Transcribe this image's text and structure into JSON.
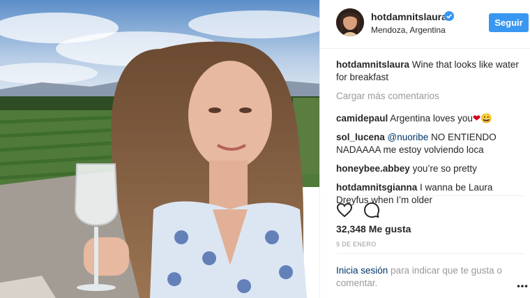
{
  "post": {
    "username": "hotdamnitslaura",
    "location": "Mendoza, Argentina",
    "follow_label": "Seguir",
    "caption": "Wine that looks like water for breakfast",
    "load_more": "Cargar más comentarios",
    "likes": "32,348 Me gusta",
    "date": "9 DE ENERO",
    "login_link": "Inicia sesión",
    "login_text": " para indicar que te gusta o comentar."
  },
  "comments": [
    {
      "user": "camidepaul",
      "text": "Argentina loves you",
      "emoji": "❤😀"
    },
    {
      "user": "sol_lucena",
      "mention": "@nuoribe",
      "text": " NO ENTIENDO NADAAAA me estoy volviendo loca"
    },
    {
      "user": "honeybee.abbey",
      "text": "you’re so pretty"
    },
    {
      "user": "hotdamnitsgianna",
      "text": "I wanna be Laura Dreyfus when I’m older"
    }
  ],
  "colors": {
    "accent": "#3897f0",
    "link": "#003569",
    "muted": "#999999"
  },
  "icons": [
    "verified-badge-icon",
    "heart-icon",
    "comment-icon",
    "more-options-icon"
  ]
}
